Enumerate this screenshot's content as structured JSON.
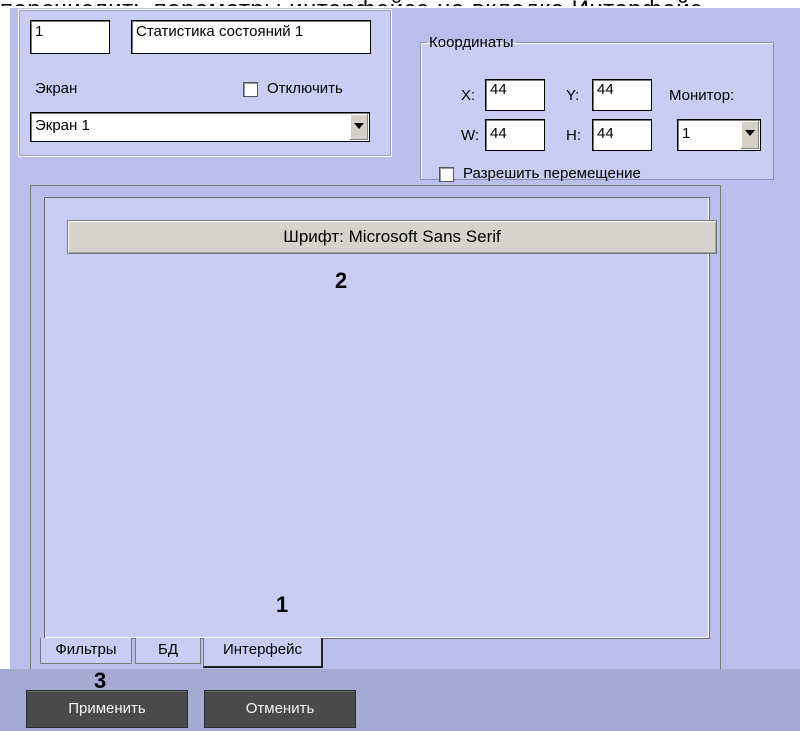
{
  "top_text": "перечислить параметры интерфейса на вкладке Интерфейс",
  "window": {
    "id_value": "1",
    "name_value": "Статистика состояний 1",
    "screen_label": "Экран",
    "disable_label": "Отключить",
    "screen_select": "Экран 1"
  },
  "coords": {
    "legend": "Координаты",
    "x_label": "X:",
    "x_value": "44",
    "y_label": "Y:",
    "y_value": "44",
    "w_label": "W:",
    "w_value": "44",
    "h_label": "H:",
    "h_value": "44",
    "monitor_label": "Монитор:",
    "monitor_value": "1",
    "allow_move_label": "Разрешить перемещение"
  },
  "interface": {
    "font_button": "Шрифт: Microsoft Sans Serif"
  },
  "tabs": [
    {
      "label": "Фильтры"
    },
    {
      "label": "БД"
    },
    {
      "label": "Интерфейс"
    }
  ],
  "callouts": {
    "one": "1",
    "two": "2",
    "three": "3"
  },
  "buttons": {
    "apply": "Применить",
    "cancel": "Отменить"
  },
  "colors": {
    "panel_bg": "#b9bfea",
    "group_bg": "#c9cdf4",
    "dark_button": "#4a4a4a"
  }
}
